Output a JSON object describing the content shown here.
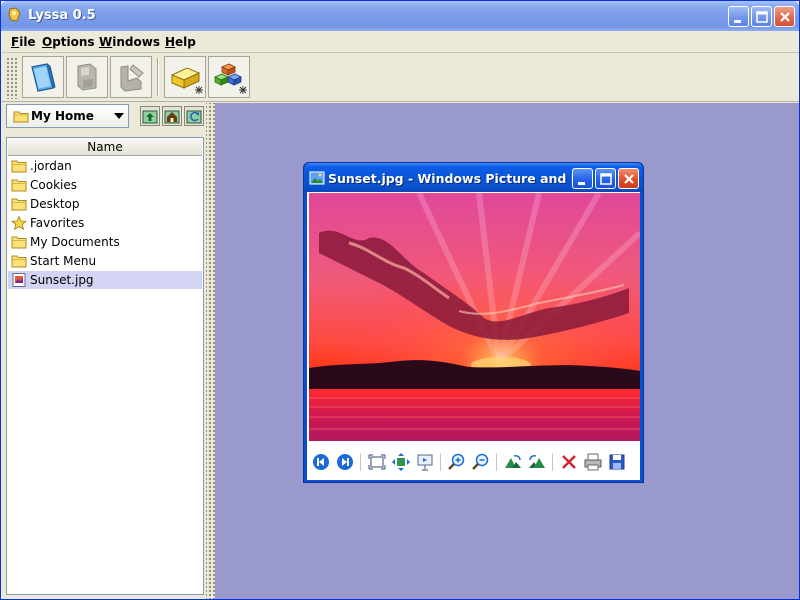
{
  "app": {
    "title": "Lyssa 0.5"
  },
  "menu": {
    "file": "ile",
    "file_accel": "F",
    "options": "ptions",
    "options_accel": "O",
    "windows": "indows",
    "windows_accel": "W",
    "help": "elp",
    "help_accel": "H"
  },
  "toolbar": {
    "buttons": [
      {
        "icon": "browser-window-icon"
      },
      {
        "icon": "disk-icon"
      },
      {
        "icon": "tools-icon"
      },
      {
        "icon": "new-block-icon"
      },
      {
        "icon": "new-blocks-icon"
      }
    ]
  },
  "left_panel": {
    "location": "My Home",
    "nav_buttons": [
      "up-folder-icon",
      "home-folder-icon",
      "refresh-folder-icon"
    ],
    "column_header": "Name",
    "files": [
      {
        "name": ".jordan",
        "icon": "folder-icon",
        "selected": false
      },
      {
        "name": "Cookies",
        "icon": "folder-icon",
        "selected": false
      },
      {
        "name": "Desktop",
        "icon": "folder-icon",
        "selected": false
      },
      {
        "name": "Favorites",
        "icon": "star-icon",
        "selected": false
      },
      {
        "name": "My Documents",
        "icon": "folder-icon",
        "selected": false
      },
      {
        "name": "Start Menu",
        "icon": "folder-icon",
        "selected": false
      },
      {
        "name": "Sunset.jpg",
        "icon": "image-file-icon",
        "selected": true
      }
    ]
  },
  "viewer": {
    "title": "Sunset.jpg - Windows Picture and F...",
    "toolbar_icons": [
      "previous-image-icon",
      "next-image-icon",
      "best-fit-icon",
      "actual-size-icon",
      "slideshow-icon",
      "zoom-in-icon",
      "zoom-out-icon",
      "rotate-clockwise-icon",
      "rotate-counterclockwise-icon",
      "delete-icon",
      "print-icon",
      "save-icon"
    ]
  },
  "colors": {
    "desktop": "#9999cc",
    "selection": "#d3d3f3",
    "xp_title_blue": "#0a55d6",
    "app_title_blue": "#7b9cea"
  }
}
